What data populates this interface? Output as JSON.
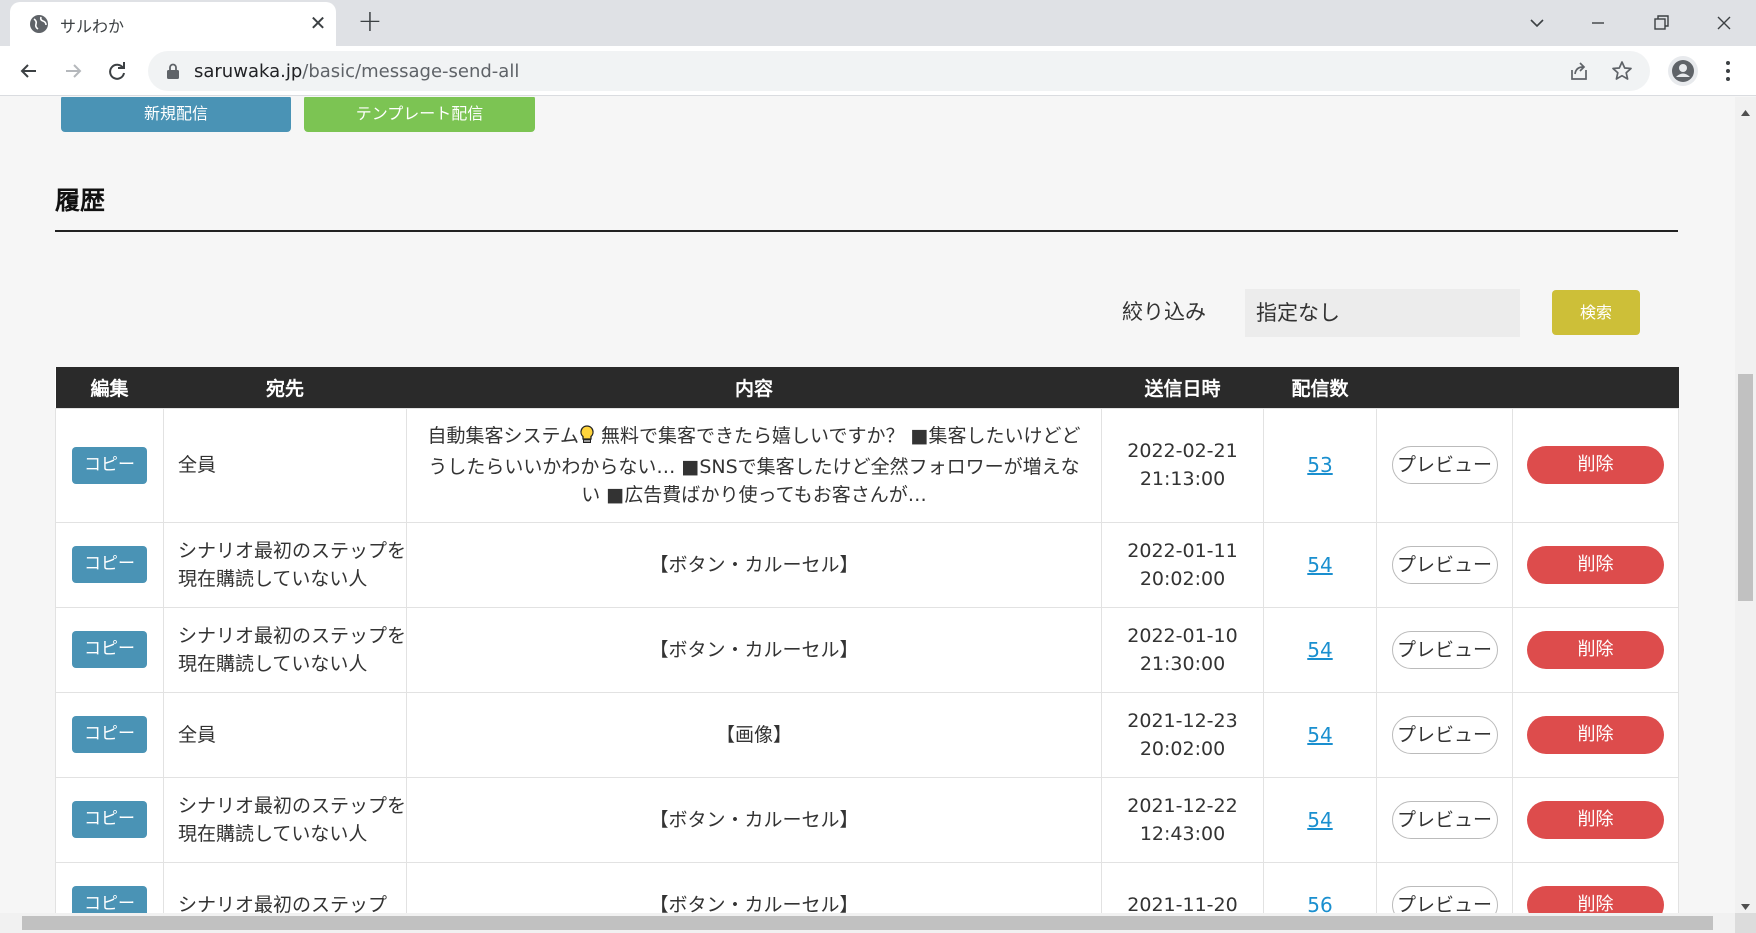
{
  "browser": {
    "tab_title": "サルわか",
    "url_domain": "saruwaka.jp",
    "url_path": "/basic/message-send-all"
  },
  "actions": {
    "new_broadcast": "新規配信",
    "template_broadcast": "テンプレート配信"
  },
  "history": {
    "title": "履歴",
    "filter_label": "絞り込み",
    "filter_value": "指定なし",
    "search_label": "検索",
    "columns": {
      "edit": "編集",
      "target": "宛先",
      "content": "内容",
      "sent_at": "送信日時",
      "count": "配信数"
    },
    "copy_label": "コピー",
    "preview_label": "プレビュー",
    "delete_label": "削除",
    "rows": [
      {
        "target": "全員",
        "content_pre": "自動集客システム",
        "content_post": " 無料で集客できたら嬉しいですか？ ■集客したいけどどうしたらいいかわからない… ■SNSで集客したけど全然フォロワーが増えない ■広告費ばかり使ってもお客さんが…",
        "date": "2022-02-21",
        "time": "21:13:00",
        "count": "53"
      },
      {
        "target": "シナリオ最初のステップを現在購読していない人",
        "content_pre": "【ボタン・カルーセル】",
        "content_post": "",
        "date": "2022-01-11",
        "time": "20:02:00",
        "count": "54"
      },
      {
        "target": "シナリオ最初のステップを現在購読していない人",
        "content_pre": "【ボタン・カルーセル】",
        "content_post": "",
        "date": "2022-01-10",
        "time": "21:30:00",
        "count": "54"
      },
      {
        "target": "全員",
        "content_pre": "【画像】",
        "content_post": "",
        "date": "2021-12-23",
        "time": "20:02:00",
        "count": "54"
      },
      {
        "target": "シナリオ最初のステップを現在購読していない人",
        "content_pre": "【ボタン・カルーセル】",
        "content_post": "",
        "date": "2021-12-22",
        "time": "12:43:00",
        "count": "54"
      },
      {
        "target": "シナリオ最初のステップ",
        "content_pre": "【ボタン・カルーセル】",
        "content_post": "",
        "date": "2021-11-20",
        "time": "",
        "count": "56"
      }
    ]
  },
  "colors": {
    "copy_button": "#4a93b5",
    "new_button": "#4a93b5",
    "template_button": "#7cc453",
    "search_button": "#cdbf38",
    "delete_button": "#dd4c4c",
    "table_header": "#2a2a2a",
    "link": "#1a8fcf"
  },
  "icons": {
    "tab_favicon": "globe-icon",
    "content_emoji": "light-bulb-icon"
  }
}
